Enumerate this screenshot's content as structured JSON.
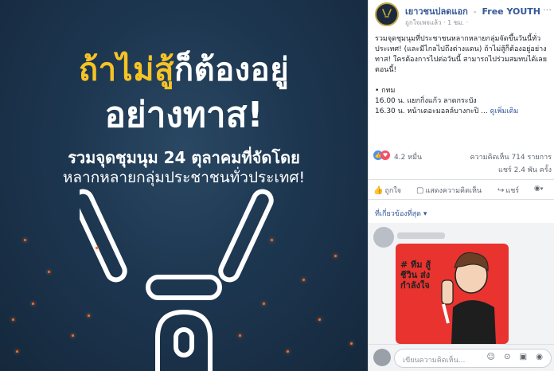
{
  "poster": {
    "headline_yellow": "ถ้าไม่สู้",
    "headline_rest": "ก็ต้องอยู่",
    "headline_line2": "อย่างทาส!",
    "sub_line1": "รวมจุดชุมนุม 24 ตุลาคมที่จัดโดย",
    "sub_line2": "หลากหลายกลุ่มประชาชนทั่วประเทศ!",
    "colors": {
      "yellow": "#f6c325",
      "bg": "#1d3650",
      "spark": "#ff6a2a"
    }
  },
  "post": {
    "page_name": "เยาวชนปลดแอก",
    "separator": "-",
    "page_name_en": "Free YOUTH",
    "subline": "ถูกใจเพจแล้ว · 1 ชม. ·",
    "more_icon": "…",
    "paragraph1": "รวมจุดชุมนุมที่ประชาชนหลากหลายกลุ่มจัดขึ้นวันนี้ทั่วประเทศ! (และมีไกลไปถึงต่างแดน) ถ้าไม่สู้ก็ต้องอยู่อย่างทาส! ใครต้องการไปต่อวันนี้ สามารถไปร่วมสมทบได้เลยตอนนี้!",
    "bullet": "• กทม",
    "line_1600": "16.00 น. แยกกิ่งแก้ว ลาดกระบัง",
    "line_1630": "16.30 น. หน้าเดอะมอลล์บางกะปิ ...",
    "see_more": "ดูเพิ่มเติม"
  },
  "reactions": {
    "count": "4.2 หมื่น",
    "comments": "ความคิดเห็น 714 รายการ",
    "shares": "แชร์ 2.4 พัน ครั้ง"
  },
  "actions": {
    "like": "ถูกใจ",
    "comment": "แสดงความคิดเห็น",
    "share": "แชร์"
  },
  "comments": {
    "filter": "ที่เกี่ยวข้องที่สุด ▾",
    "sticker_text": "# ทีม สู้ชีวิน ส่ง กำลังใจ"
  },
  "composer": {
    "placeholder": "เขียนความคิดเห็น...",
    "icons": "☺ ⊙ ▣ ◉"
  }
}
